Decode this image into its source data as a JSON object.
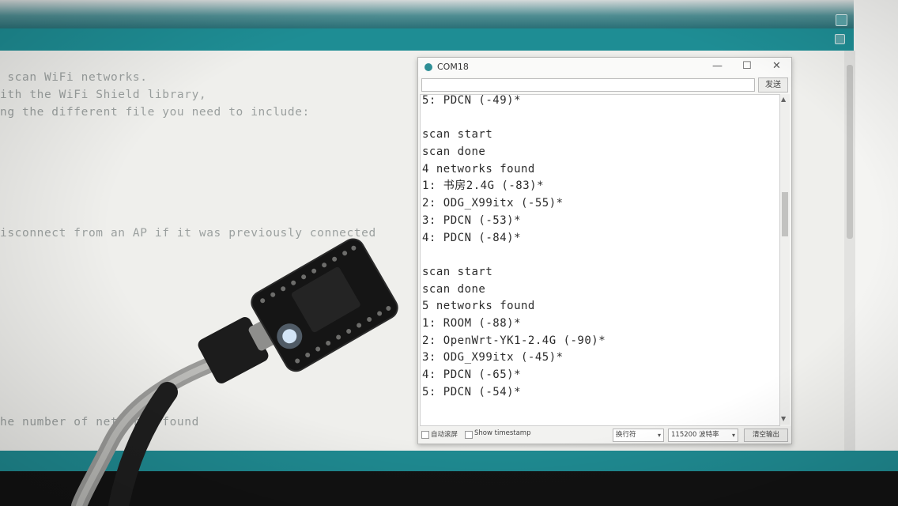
{
  "ide": {
    "code_lines": [
      " scan WiFi networks.",
      "ith the WiFi Shield library,",
      "ng the different file you need to include:",
      "isconnect from an AP if it was previously connected",
      "he number of networks found"
    ]
  },
  "serial_monitor": {
    "title": "COM18",
    "window_buttons": [
      "—",
      "☐",
      "✕"
    ],
    "send_label": "发送",
    "input_value": "",
    "output": [
      "5: PDCN (-49)*",
      "",
      "scan start",
      "scan done",
      "4 networks found",
      "1: 书房2.4G (-83)*",
      "2: ODG_X99itx (-55)*",
      "3: PDCN (-53)*",
      "4: PDCN (-84)*",
      "",
      "scan start",
      "scan done",
      "5 networks found",
      "1: ROOM (-88)*",
      "2: OpenWrt-YK1-2.4G (-90)*",
      "3: ODG_X99itx (-45)*",
      "4: PDCN (-65)*",
      "5: PDCN (-54)*"
    ],
    "autoscroll_label": "自动滚屏",
    "timestamp_label": "Show timestamp",
    "line_ending": "换行符",
    "baud_rate": "115200 波特率",
    "clear_label": "清空输出"
  },
  "colors": {
    "ide_teal": "#1e8d94",
    "console_bg": "#121212"
  },
  "objects": {
    "board": "dev-board-icon",
    "cable": "usb-cable-icon"
  }
}
